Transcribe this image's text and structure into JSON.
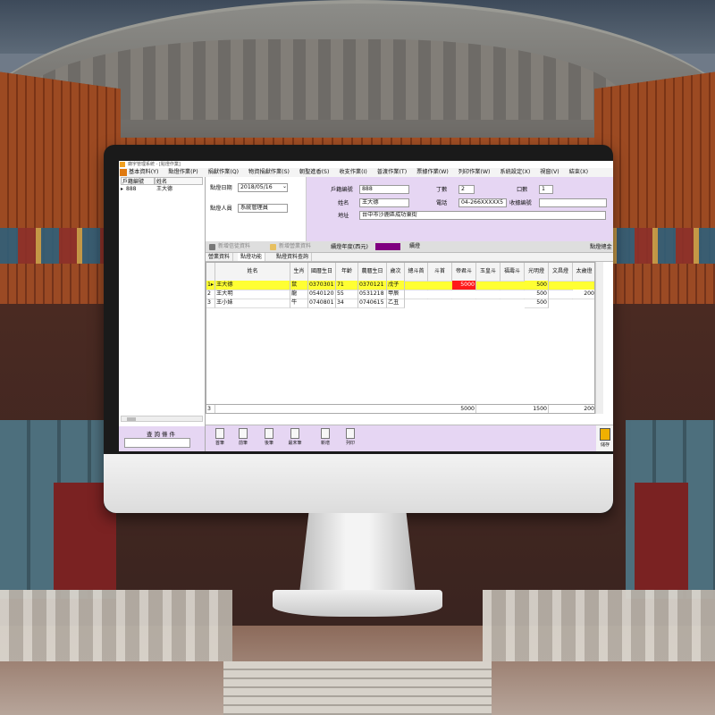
{
  "window": {
    "title": "廟宇管理系統 - [點燈作業]"
  },
  "menu": [
    "基本資料(Y)",
    "點燈作業(P)",
    "捐獻作業(Q)",
    "物資捐獻作業(S)",
    "朝聖進香(S)",
    "收支作業(I)",
    "普渡作業(T)",
    "票據作業(W)",
    "列印作業(W)",
    "系統設定(X)",
    "視窗(V)",
    "結束(X)"
  ],
  "left_panel": {
    "headers": [
      "戶籍編號",
      "姓名"
    ],
    "rows": [
      {
        "id": "888",
        "name": "王大德"
      }
    ],
    "query_label": "查詢條件",
    "query_value": ""
  },
  "form": {
    "date_label": "點燈日期",
    "date_value": "2018/05/16",
    "staff_label": "點燈人員",
    "staff_value": "系統管理員",
    "household_label": "戶籍編號",
    "household_value": "888",
    "males_label": "丁數",
    "males_value": "2",
    "members_label": "口數",
    "members_value": "1",
    "name_label": "姓名",
    "name_value": "王大德",
    "phone_label": "電話",
    "phone_value": "04-266XXXXX5",
    "receipt_label": "收據編號",
    "receipt_value": "",
    "address_label": "地址",
    "address_value": "台中市沙鹿區成功東街"
  },
  "toolbar2": {
    "new_believer": "新增信徒資料",
    "new_family": "新增營業資料",
    "renew_label": "續燈年度(西元)",
    "renew_button": "續燈",
    "right_text": "點燈總金"
  },
  "tabs": [
    "營業資料",
    "點燈功能",
    "點燈資料查詢"
  ],
  "grid": {
    "headers": [
      "",
      "姓名",
      "生肖",
      "國曆生日",
      "年齡",
      "農曆生日",
      "歲次",
      "總斗首",
      "斗首",
      "帝君斗",
      "玉皇斗",
      "福壽斗",
      "光明燈",
      "文昌燈",
      "太歲燈"
    ],
    "rows": [
      {
        "no": "1",
        "name": "王大德",
        "zodiac": "鼠",
        "solar": "0370301",
        "age": "71",
        "lunar": "0370121",
        "year": "戊子",
        "c1": "",
        "c2": "",
        "dijun": "5000",
        "yuhuang": "",
        "fushou": "",
        "guangming": "500",
        "wenchang": "",
        "taisui": ""
      },
      {
        "no": "2",
        "name": "王大明",
        "zodiac": "龍",
        "solar": "0540120",
        "age": "55",
        "lunar": "0531218",
        "year": "甲辰",
        "c1": "",
        "c2": "",
        "dijun": "",
        "yuhuang": "",
        "fushou": "",
        "guangming": "500",
        "wenchang": "",
        "taisui": "200"
      },
      {
        "no": "3",
        "name": "王小妹",
        "zodiac": "牛",
        "solar": "0740801",
        "age": "34",
        "lunar": "0740615",
        "year": "乙丑",
        "c1": "",
        "c2": "",
        "dijun": "",
        "yuhuang": "",
        "fushou": "",
        "guangming": "500",
        "wenchang": "",
        "taisui": ""
      }
    ],
    "selected_row_marker": "1▸",
    "totals": {
      "count": "3",
      "dijun": "5000",
      "guangming": "1500",
      "taisui": "200"
    }
  },
  "bottom_nav": [
    "首筆",
    "前筆",
    "後筆",
    "最末筆",
    "新增",
    "列印"
  ],
  "save_button": "儲存",
  "colors": {
    "accent": "#e6d6f3",
    "selected_row": "#ffff33",
    "highlight_cell": "#ff1a1a",
    "renew_swatch": "#800080"
  }
}
